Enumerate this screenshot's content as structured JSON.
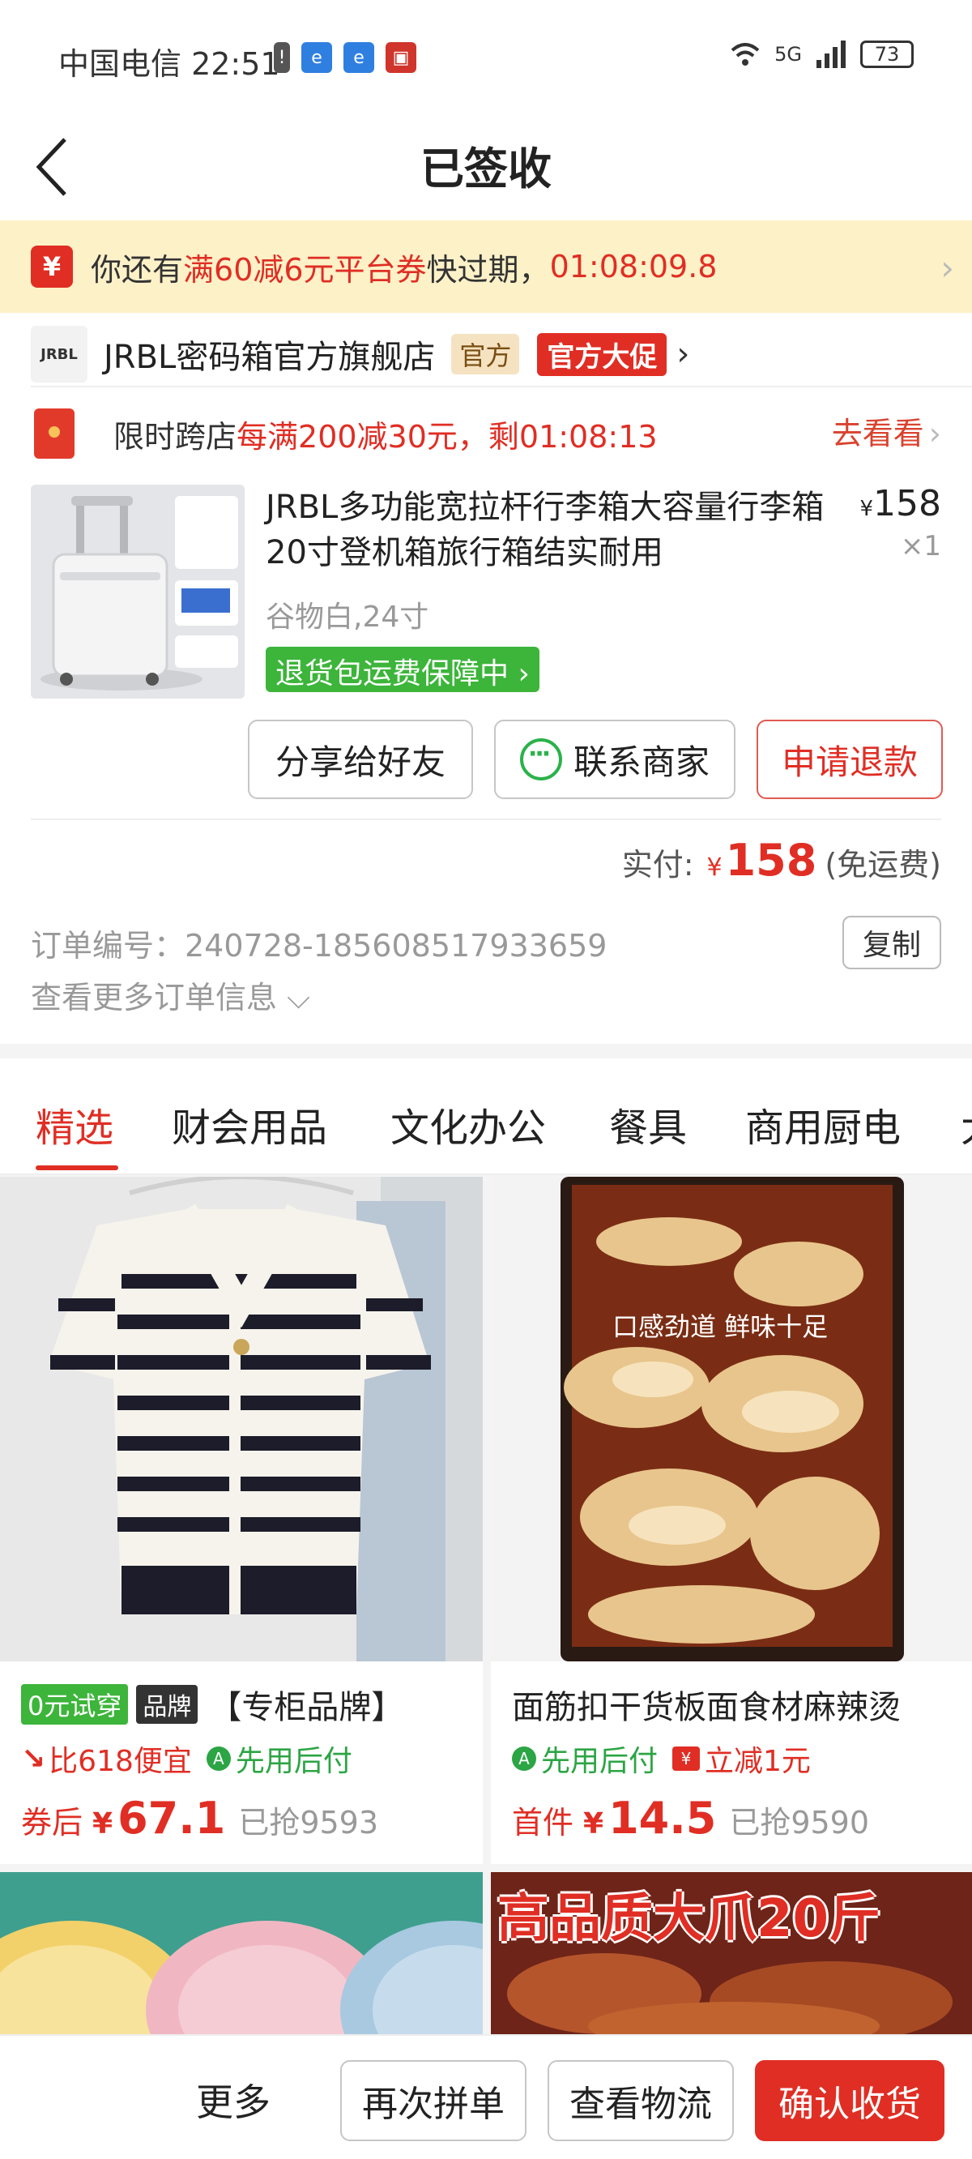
{
  "status_bar": {
    "carrier_time": "中国电信 22:51",
    "network": "5G",
    "battery": "73"
  },
  "header": {
    "title": "已签收"
  },
  "coupon_banner": {
    "icon": "¥",
    "text_prefix": "你还有",
    "text_highlight": "满60减6元平台券",
    "text_suffix": "快过期，",
    "countdown": "01:08:09.8"
  },
  "shop": {
    "logo": "JRBL",
    "name": "JRBL密码箱官方旗舰店",
    "tag_official": "官方",
    "tag_promo": "官方大促"
  },
  "cross_store": {
    "label": "限时跨店",
    "offer": "每满200减30元，剩01:08:13",
    "action": "去看看"
  },
  "product": {
    "name": "JRBL多功能宽拉杆行李箱大容量行李箱20寸登机箱旅行箱结实耐用",
    "currency": "¥",
    "price": "158",
    "qty": "×1",
    "spec": "谷物白,24寸",
    "guarantee": "退货包运费保障中"
  },
  "actions": {
    "share": "分享给好友",
    "contact": "联系商家",
    "refund": "申请退款"
  },
  "payment": {
    "label": "实付:",
    "currency": "¥",
    "amount": "158",
    "note": "(免运费)"
  },
  "order_info": {
    "order_no": "订单编号：240728-185608517933659",
    "copy": "复制",
    "more": "查看更多订单信息"
  },
  "tabs": [
    "精选",
    "财会用品",
    "文化办公",
    "餐具",
    "商用厨电",
    "大"
  ],
  "feed": [
    {
      "tag_try": "0元试穿",
      "tag_brand": "品牌",
      "title": "【专柜品牌】",
      "tip1": "比618便宜",
      "tip2": "先用后付",
      "price_label": "券后",
      "currency": "¥",
      "price": "67.1",
      "sold": "已抢9593"
    },
    {
      "title": "面筋扣干货板面食材麻辣烫",
      "tip1": "先用后付",
      "tip2": "立减1元",
      "image_caption": "口感劲道  鲜味十足",
      "price_label": "首件",
      "currency": "¥",
      "price": "14.5",
      "sold": "已抢9590"
    }
  ],
  "feed_banner_text": "高品质大爪20斤",
  "bottom_bar": {
    "more": "更多",
    "reorder": "再次拼单",
    "track": "查看物流",
    "confirm": "确认收货"
  },
  "colors": {
    "accent_red": "#e02e24",
    "green": "#3cb53a",
    "banner_bg": "#fdf1c8"
  }
}
